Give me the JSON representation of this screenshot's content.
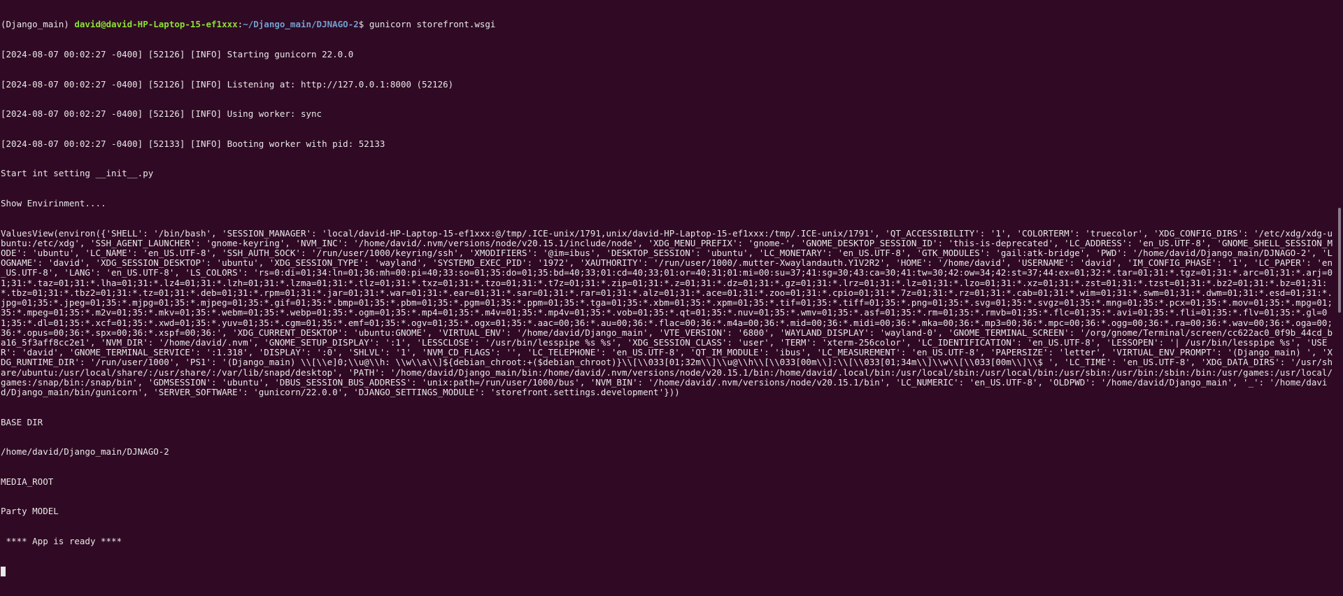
{
  "prompt": {
    "env": "(Django_main) ",
    "user_host": "david@david-HP-Laptop-15-ef1xxx",
    "colon": ":",
    "path": "~/Django_main/DJNAGO-2",
    "symbol": "$ ",
    "command": "gunicorn storefront.wsgi"
  },
  "output_lines": [
    "[2024-08-07 00:02:27 -0400] [52126] [INFO] Starting gunicorn 22.0.0",
    "[2024-08-07 00:02:27 -0400] [52126] [INFO] Listening at: http://127.0.0.1:8000 (52126)",
    "[2024-08-07 00:02:27 -0400] [52126] [INFO] Using worker: sync",
    "[2024-08-07 00:02:27 -0400] [52133] [INFO] Booting worker with pid: 52133",
    "Start int setting __init__.py",
    "Show Envirinment....",
    "ValuesView(environ({'SHELL': '/bin/bash', 'SESSION_MANAGER': 'local/david-HP-Laptop-15-ef1xxx:@/tmp/.ICE-unix/1791,unix/david-HP-Laptop-15-ef1xxx:/tmp/.ICE-unix/1791', 'QT_ACCESSIBILITY': '1', 'COLORTERM': 'truecolor', 'XDG_CONFIG_DIRS': '/etc/xdg/xdg-ubuntu:/etc/xdg', 'SSH_AGENT_LAUNCHER': 'gnome-keyring', 'NVM_INC': '/home/david/.nvm/versions/node/v20.15.1/include/node', 'XDG_MENU_PREFIX': 'gnome-', 'GNOME_DESKTOP_SESSION_ID': 'this-is-deprecated', 'LC_ADDRESS': 'en_US.UTF-8', 'GNOME_SHELL_SESSION_MODE': 'ubuntu', 'LC_NAME': 'en_US.UTF-8', 'SSH_AUTH_SOCK': '/run/user/1000/keyring/ssh', 'XMODIFIERS': '@im=ibus', 'DESKTOP_SESSION': 'ubuntu', 'LC_MONETARY': 'en_US.UTF-8', 'GTK_MODULES': 'gail:atk-bridge', 'PWD': '/home/david/Django_main/DJNAGO-2', 'LOGNAME': 'david', 'XDG_SESSION_DESKTOP': 'ubuntu', 'XDG_SESSION_TYPE': 'wayland', 'SYSTEMD_EXEC_PID': '1972', 'XAUTHORITY': '/run/user/1000/.mutter-Xwaylandauth.Y1V2R2', 'HOME': '/home/david', 'USERNAME': 'david', 'IM_CONFIG_PHASE': '1', 'LC_PAPER': 'en_US.UTF-8', 'LANG': 'en_US.UTF-8', 'LS_COLORS': 'rs=0:di=01;34:ln=01;36:mh=00:pi=40;33:so=01;35:do=01;35:bd=40;33;01:cd=40;33;01:or=40;31;01:mi=00:su=37;41:sg=30;43:ca=30;41:tw=30;42:ow=34;42:st=37;44:ex=01;32:*.tar=01;31:*.tgz=01;31:*.arc=01;31:*.arj=01;31:*.taz=01;31:*.lha=01;31:*.lz4=01;31:*.lzh=01;31:*.lzma=01;31:*.tlz=01;31:*.txz=01;31:*.tzo=01;31:*.t7z=01;31:*.zip=01;31:*.z=01;31:*.dz=01;31:*.gz=01;31:*.lrz=01;31:*.lz=01;31:*.lzo=01;31:*.xz=01;31:*.zst=01;31:*.tzst=01;31:*.bz2=01;31:*.bz=01;31:*.tbz=01;31:*.tbz2=01;31:*.tz=01;31:*.deb=01;31:*.rpm=01;31:*.jar=01;31:*.war=01;31:*.ear=01;31:*.sar=01;31:*.rar=01;31:*.alz=01;31:*.ace=01;31:*.zoo=01;31:*.cpio=01;31:*.7z=01;31:*.rz=01;31:*.cab=01;31:*.wim=01;31:*.swm=01;31:*.dwm=01;31:*.esd=01;31:*.jpg=01;35:*.jpeg=01;35:*.mjpg=01;35:*.mjpeg=01;35:*.gif=01;35:*.bmp=01;35:*.pbm=01;35:*.pgm=01;35:*.ppm=01;35:*.tga=01;35:*.xbm=01;35:*.xpm=01;35:*.tif=01;35:*.tiff=01;35:*.png=01;35:*.svg=01;35:*.svgz=01;35:*.mng=01;35:*.pcx=01;35:*.mov=01;35:*.mpg=01;35:*.mpeg=01;35:*.m2v=01;35:*.mkv=01;35:*.webm=01;35:*.webp=01;35:*.ogm=01;35:*.mp4=01;35:*.m4v=01;35:*.mp4v=01;35:*.vob=01;35:*.qt=01;35:*.nuv=01;35:*.wmv=01;35:*.asf=01;35:*.rm=01;35:*.rmvb=01;35:*.flc=01;35:*.avi=01;35:*.fli=01;35:*.flv=01;35:*.gl=01;35:*.dl=01;35:*.xcf=01;35:*.xwd=01;35:*.yuv=01;35:*.cgm=01;35:*.emf=01;35:*.ogv=01;35:*.ogx=01;35:*.aac=00;36:*.au=00;36:*.flac=00;36:*.m4a=00;36:*.mid=00;36:*.midi=00;36:*.mka=00;36:*.mp3=00;36:*.mpc=00;36:*.ogg=00;36:*.ra=00;36:*.wav=00;36:*.oga=00;36:*.opus=00;36:*.spx=00;36:*.xspf=00;36:', 'XDG_CURRENT_DESKTOP': 'ubuntu:GNOME', 'VIRTUAL_ENV': '/home/david/Django_main', 'VTE_VERSION': '6800', 'WAYLAND_DISPLAY': 'wayland-0', 'GNOME_TERMINAL_SCREEN': '/org/gnome/Terminal/screen/cc622ac0_0f9b_44cd_ba16_5f3aff8cc2e1', 'NVM_DIR': '/home/david/.nvm', 'GNOME_SETUP_DISPLAY': ':1', 'LESSCLOSE': '/usr/bin/lesspipe %s %s', 'XDG_SESSION_CLASS': 'user', 'TERM': 'xterm-256color', 'LC_IDENTIFICATION': 'en_US.UTF-8', 'LESSOPEN': '| /usr/bin/lesspipe %s', 'USER': 'david', 'GNOME_TERMINAL_SERVICE': ':1.318', 'DISPLAY': ':0', 'SHLVL': '1', 'NVM_CD_FLAGS': '', 'LC_TELEPHONE': 'en_US.UTF-8', 'QT_IM_MODULE': 'ibus', 'LC_MEASUREMENT': 'en_US.UTF-8', 'PAPERSIZE': 'letter', 'VIRTUAL_ENV_PROMPT': '(Django_main) ', 'XDG_RUNTIME_DIR': '/run/user/1000', 'PS1': '(Django_main) \\\\[\\\\e]0;\\\\u@\\\\h: \\\\w\\\\a\\\\]${debian_chroot:+($debian_chroot)}\\\\[\\\\033[01;32m\\\\]\\\\u@\\\\h\\\\[\\\\033[00m\\\\]:\\\\[\\\\033[01;34m\\\\]\\\\w\\\\[\\\\033[00m\\\\]\\\\$ ', 'LC_TIME': 'en_US.UTF-8', 'XDG_DATA_DIRS': '/usr/share/ubuntu:/usr/local/share/:/usr/share/:/var/lib/snapd/desktop', 'PATH': '/home/david/Django_main/bin:/home/david/.nvm/versions/node/v20.15.1/bin:/home/david/.local/bin:/usr/local/sbin:/usr/local/bin:/usr/sbin:/usr/bin:/sbin:/bin:/usr/games:/usr/local/games:/snap/bin:/snap/bin', 'GDMSESSION': 'ubuntu', 'DBUS_SESSION_BUS_ADDRESS': 'unix:path=/run/user/1000/bus', 'NVM_BIN': '/home/david/.nvm/versions/node/v20.15.1/bin', 'LC_NUMERIC': 'en_US.UTF-8', 'OLDPWD': '/home/david/Django_main', '_': '/home/david/Django_main/bin/gunicorn', 'SERVER_SOFTWARE': 'gunicorn/22.0.0', 'DJANGO_SETTINGS_MODULE': 'storefront.settings.development'}))",
    "BASE DIR",
    "/home/david/Django_main/DJNAGO-2",
    "MEDIA_ROOT",
    "Party MODEL",
    " **** App is ready ****"
  ],
  "colors": {
    "background": "#300a24",
    "text": "#e8e8e8",
    "user_host": "#8ae234",
    "path": "#729fcf"
  }
}
